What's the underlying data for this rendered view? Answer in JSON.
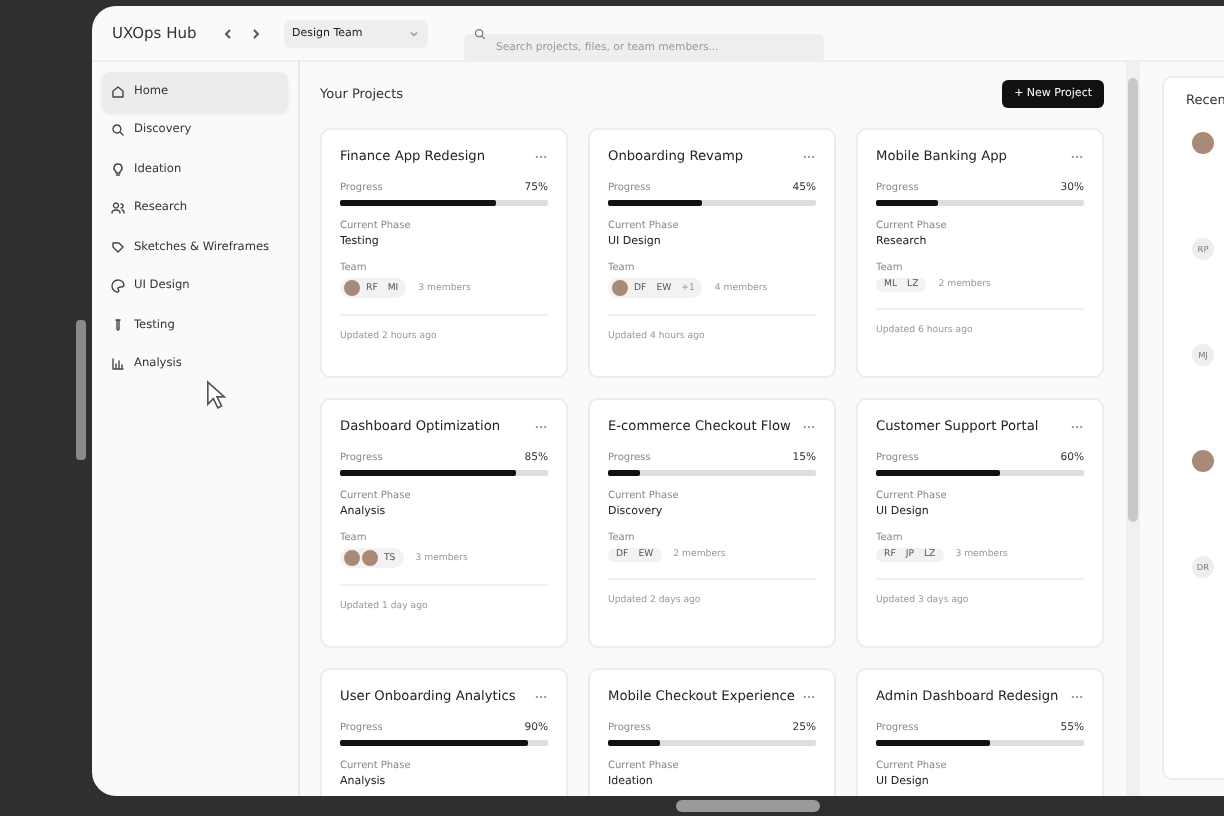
{
  "app": {
    "title": "UXOps Hub",
    "team_select": "Design Team",
    "search": {
      "placeholder": "Search projects, files, or team members..."
    }
  },
  "sidebar": {
    "items": [
      {
        "label": "Home",
        "selected": true
      },
      {
        "label": "Discovery",
        "selected": false
      },
      {
        "label": "Ideation",
        "selected": false
      },
      {
        "label": "Research",
        "selected": false
      },
      {
        "label": "Sketches & Wireframes",
        "selected": false
      },
      {
        "label": "UI Design",
        "selected": false
      },
      {
        "label": "Testing",
        "selected": false
      },
      {
        "label": "Analysis",
        "selected": false
      }
    ]
  },
  "projects": {
    "title": "Your Projects",
    "new_button": "+ New Project",
    "cards": [
      {
        "name": "Finance App Redesign",
        "progress_label": "Progress",
        "percent": "75%",
        "level": 0.75,
        "phase_label": "Current Phase",
        "phase": "Testing",
        "team_label": "Team",
        "members": [
          {
            "kind": "photo"
          },
          {
            "kind": "initials",
            "text": "RF"
          },
          {
            "kind": "initials",
            "text": "MI"
          }
        ],
        "member_count": "3 members",
        "updated": "Updated 2 hours ago"
      },
      {
        "name": "Onboarding Revamp",
        "progress_label": "Progress",
        "percent": "45%",
        "level": 0.45,
        "phase_label": "Current Phase",
        "phase": "UI Design",
        "team_label": "Team",
        "members": [
          {
            "kind": "photo"
          },
          {
            "kind": "initials",
            "text": "DF"
          },
          {
            "kind": "initials",
            "text": "EW"
          },
          {
            "kind": "more",
            "text": "+1"
          }
        ],
        "member_count": "4 members",
        "updated": "Updated 4 hours ago"
      },
      {
        "name": "Mobile Banking App",
        "progress_label": "Progress",
        "percent": "30%",
        "level": 0.3,
        "phase_label": "Current Phase",
        "phase": "Research",
        "team_label": "Team",
        "members": [
          {
            "kind": "initials",
            "text": "ML"
          },
          {
            "kind": "initials",
            "text": "LZ"
          }
        ],
        "member_count": "2 members",
        "updated": "Updated 6 hours ago"
      },
      {
        "name": "Dashboard Optimization",
        "progress_label": "Progress",
        "percent": "85%",
        "level": 0.85,
        "phase_label": "Current Phase",
        "phase": "Analysis",
        "team_label": "Team",
        "members": [
          {
            "kind": "photo"
          },
          {
            "kind": "photo"
          },
          {
            "kind": "initials",
            "text": "TS"
          }
        ],
        "member_count": "3 members",
        "updated": "Updated 1 day ago"
      },
      {
        "name": "E-commerce Checkout Flow",
        "progress_label": "Progress",
        "percent": "15%",
        "level": 0.15,
        "phase_label": "Current Phase",
        "phase": "Discovery",
        "team_label": "Team",
        "members": [
          {
            "kind": "initials",
            "text": "DF"
          },
          {
            "kind": "initials",
            "text": "EW"
          }
        ],
        "member_count": "2 members",
        "updated": "Updated 2 days ago"
      },
      {
        "name": "Customer Support Portal",
        "progress_label": "Progress",
        "percent": "60%",
        "level": 0.6,
        "phase_label": "Current Phase",
        "phase": "UI Design",
        "team_label": "Team",
        "members": [
          {
            "kind": "initials",
            "text": "RF"
          },
          {
            "kind": "initials",
            "text": "JP"
          },
          {
            "kind": "initials",
            "text": "LZ"
          }
        ],
        "member_count": "3 members",
        "updated": "Updated 3 days ago"
      },
      {
        "name": "User Onboarding Analytics",
        "progress_label": "Progress",
        "percent": "90%",
        "level": 0.9,
        "phase_label": "Current Phase",
        "phase": "Analysis"
      },
      {
        "name": "Mobile Checkout Experience",
        "progress_label": "Progress",
        "percent": "25%",
        "level": 0.25,
        "phase_label": "Current Phase",
        "phase": "Ideation"
      },
      {
        "name": "Admin Dashboard Redesign",
        "progress_label": "Progress",
        "percent": "55%",
        "level": 0.55,
        "phase_label": "Current Phase",
        "phase": "UI Design"
      }
    ]
  },
  "recent": {
    "title": "Recen",
    "avatars": [
      {
        "kind": "photo"
      },
      {
        "kind": "initials",
        "text": "RP"
      },
      {
        "kind": "initials",
        "text": "MJ"
      },
      {
        "kind": "photo"
      },
      {
        "kind": "initials",
        "text": "DR"
      }
    ]
  }
}
